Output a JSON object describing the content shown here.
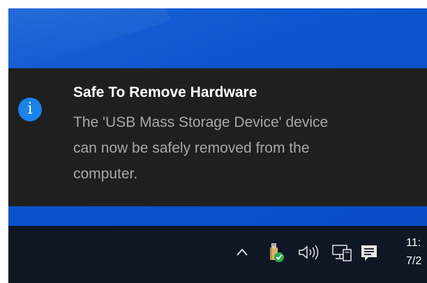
{
  "notification": {
    "icon": "info-icon",
    "icon_glyph": "i",
    "title": "Safe To Remove Hardware",
    "body_lines": [
      "The 'USB Mass Storage Device' device",
      "can now be safely removed from the",
      "computer."
    ],
    "accent_color": "#1a82e8",
    "background_color": "#1f1f1f"
  },
  "taskbar": {
    "tray_icons": [
      "chevron-up-icon",
      "usb-safely-remove-icon",
      "volume-icon",
      "network-icon",
      "action-center-icon"
    ],
    "clock": {
      "time": "11:",
      "date": "7/2"
    },
    "background_color": "#0f1725"
  },
  "desktop": {
    "background_color": "#0b53cc"
  }
}
